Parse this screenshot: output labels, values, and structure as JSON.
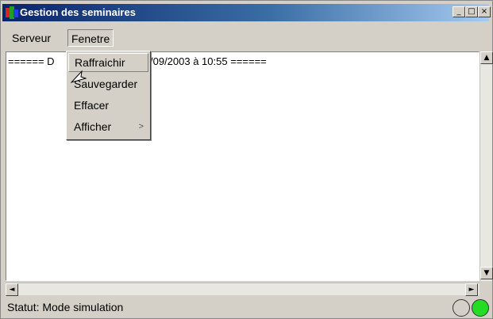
{
  "window": {
    "title": "Gestion des seminaires",
    "minimize_label": "_",
    "maximize_label": "□",
    "close_label": "×"
  },
  "menubar": {
    "items": [
      {
        "label": "Serveur"
      },
      {
        "label": "Fenetre"
      }
    ]
  },
  "dropdown": {
    "items": [
      {
        "label": "Raffraichir"
      },
      {
        "label": "Sauvegarder"
      },
      {
        "label": "Effacer"
      },
      {
        "label": "Afficher",
        "submenu_arrow": ">"
      }
    ]
  },
  "log": {
    "line_start": "====== D",
    "line_end": "/09/2003 à 10:55 ======"
  },
  "scrollbars": {
    "up_arrow": "▲",
    "down_arrow": "▼",
    "left_arrow": "◄",
    "right_arrow": "►"
  },
  "status": {
    "text": "Statut: Mode simulation"
  },
  "indicators": {
    "led_off_color": "#d4d0c8",
    "led_on_color": "#22dd22"
  },
  "colors": {
    "titlebar_start": "#0a246a",
    "titlebar_end": "#a6caf0"
  }
}
